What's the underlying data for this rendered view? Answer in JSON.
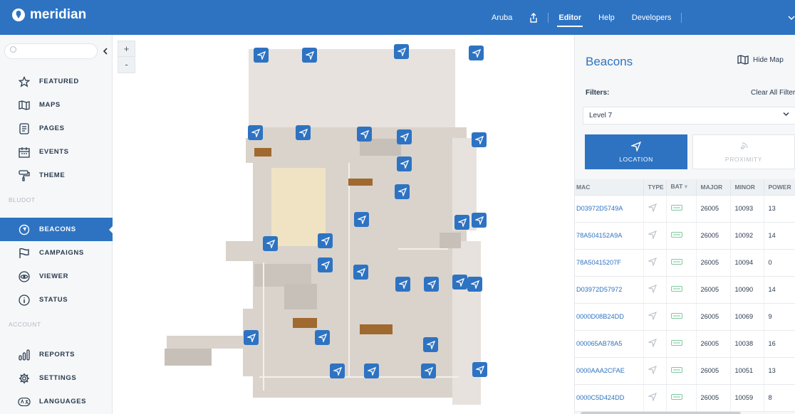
{
  "app": {
    "brand": "meridian"
  },
  "topnav": {
    "location": "Aruba",
    "editor": "Editor",
    "help": "Help",
    "developers": "Developers"
  },
  "sidebar": {
    "search_placeholder": "Q",
    "items": [
      {
        "label": "FEATURED",
        "icon": "star-icon"
      },
      {
        "label": "MAPS",
        "icon": "map-icon"
      },
      {
        "label": "PAGES",
        "icon": "pages-icon"
      },
      {
        "label": "EVENTS",
        "icon": "calendar-icon"
      },
      {
        "label": "THEME",
        "icon": "paint-roller-icon"
      }
    ],
    "section_bludot": "BLUDOT",
    "bludot_items": [
      {
        "label": "BEACONS",
        "icon": "beacon-pin-icon",
        "active": true
      },
      {
        "label": "CAMPAIGNS",
        "icon": "flag-icon"
      },
      {
        "label": "VIEWER",
        "icon": "eye-icon"
      },
      {
        "label": "STATUS",
        "icon": "info-icon"
      }
    ],
    "section_account": "ACCOUNT",
    "account_items": [
      {
        "label": "REPORTS",
        "icon": "bar-chart-icon"
      },
      {
        "label": "SETTINGS",
        "icon": "gear-icon"
      },
      {
        "label": "LANGUAGES",
        "icon": "translate-icon"
      }
    ]
  },
  "map": {
    "zoom_in": "+",
    "zoom_out": "-"
  },
  "panel": {
    "title": "Beacons",
    "hide_map": "Hide Map",
    "filters_label": "Filters:",
    "clear_all": "Clear All Filters",
    "level": "Level 7",
    "type_location": "LOCATION",
    "type_proximity": "PROXIMITY",
    "columns": [
      "MAC",
      "TYPE",
      "BAT",
      "MAJOR",
      "MINOR",
      "POWER"
    ],
    "rows": [
      {
        "mac": "D03972D5749A",
        "major": "26005",
        "minor": "10093",
        "power": "13"
      },
      {
        "mac": "78A504152A9A",
        "major": "26005",
        "minor": "10092",
        "power": "14"
      },
      {
        "mac": "78A50415207F",
        "major": "26005",
        "minor": "10094",
        "power": "0"
      },
      {
        "mac": "D03972D57972",
        "major": "26005",
        "minor": "10090",
        "power": "14"
      },
      {
        "mac": "0000D08B24DD",
        "major": "26005",
        "minor": "10069",
        "power": "9"
      },
      {
        "mac": "000065AB78A5",
        "major": "26005",
        "minor": "10038",
        "power": "16"
      },
      {
        "mac": "0000AAA2CFAE",
        "major": "26005",
        "minor": "10051",
        "power": "13"
      },
      {
        "mac": "0000C5D424DD",
        "major": "26005",
        "minor": "10059",
        "power": "8"
      }
    ]
  },
  "colors": {
    "brand_blue": "#2e73c2",
    "sidebar_bg": "#f5f7f9",
    "floor": "#d9d3cc",
    "table_wood": "#a0692f"
  }
}
